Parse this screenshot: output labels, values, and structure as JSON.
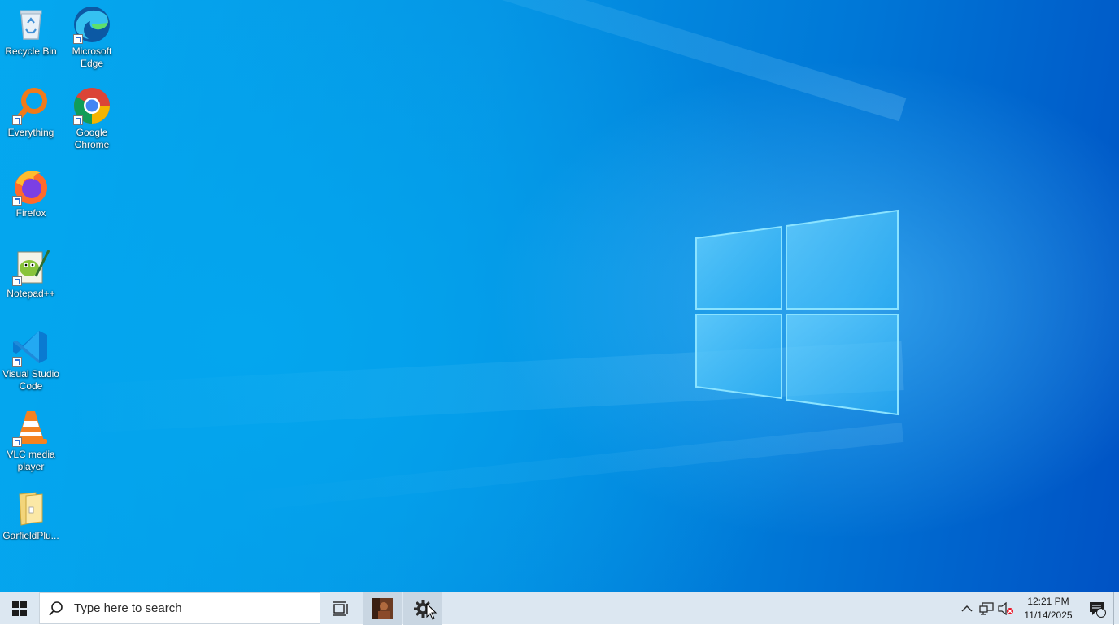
{
  "desktop": {
    "icons": [
      {
        "label": "Recycle Bin",
        "icon": "recycle-bin-icon"
      },
      {
        "label": "Microsoft Edge",
        "icon": "edge-icon"
      },
      {
        "label": "Everything",
        "icon": "everything-search-icon"
      },
      {
        "label": "Google Chrome",
        "icon": "chrome-icon"
      },
      {
        "label": "Firefox",
        "icon": "firefox-icon"
      },
      {
        "label": "Notepad++",
        "icon": "notepad-plus-plus-icon"
      },
      {
        "label": "Visual Studio Code",
        "icon": "vscode-icon"
      },
      {
        "label": "VLC media player",
        "icon": "vlc-icon"
      },
      {
        "label": "GarfieldPlu...",
        "icon": "folder-icon"
      }
    ]
  },
  "taskbar": {
    "search_placeholder": "Type here to search",
    "clock_time": "12:21 PM",
    "clock_date": "11/14/2025",
    "notification_count": "1"
  },
  "colors": {
    "wallpaper_primary": "#0594e4",
    "taskbar_bg": "#dce7f1"
  }
}
